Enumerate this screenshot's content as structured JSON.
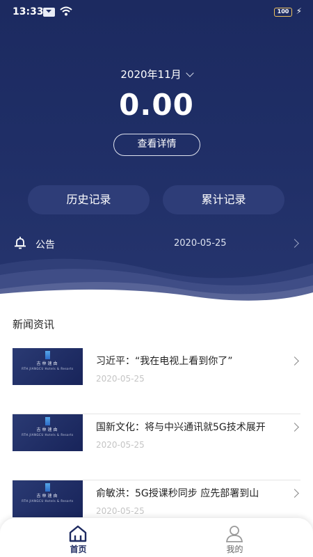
{
  "status_bar": {
    "time": "13:33",
    "battery": "100"
  },
  "summary": {
    "month": "2020年11月",
    "amount": "0.00",
    "details_button": "查看详情"
  },
  "actions": {
    "history": "历史记录",
    "cumulative": "累计记录"
  },
  "notice": {
    "label": "公告",
    "date": "2020-05-25"
  },
  "news": {
    "section_title": "新闻资讯",
    "thumb_logo_text_cn": "吉林速由",
    "thumb_logo_text_en": "RTH.JIANGCU Hotels & Resorts",
    "items": [
      {
        "title": "习近平：“我在电视上看到你了”",
        "date": "2020-05-25"
      },
      {
        "title": "国新文化：将与中兴通讯就5G技术展开",
        "date": "2020-05-25"
      },
      {
        "title": "俞敏洪：5G授课秒同步 应先部署到山",
        "date": "2020-05-25"
      }
    ]
  },
  "tab_bar": {
    "home": "首页",
    "mine": "我的"
  },
  "colors": {
    "primary_navy": "#1c2a60",
    "button_navy": "#2e3d78"
  }
}
